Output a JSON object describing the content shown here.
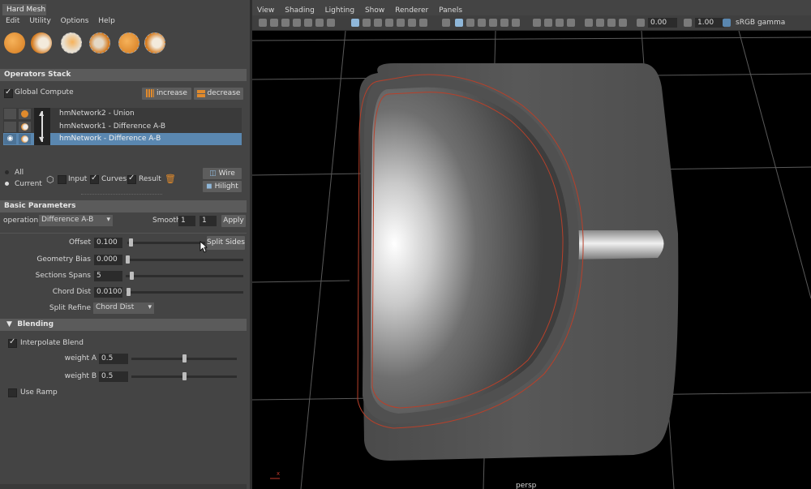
{
  "window": {
    "title": "Hard Mesh"
  },
  "menu": [
    "Edit",
    "Utility",
    "Options",
    "Help"
  ],
  "operators_stack": {
    "header": "Operators Stack",
    "global_compute": "Global Compute",
    "global_compute_checked": true,
    "increase": "increase",
    "decrease": "decrease",
    "items": [
      "hmNetwork2 - Union",
      "hmNetwork1 - Difference A-B",
      "hmNetwork - Difference A-B"
    ],
    "selected_index": 2
  },
  "display": {
    "all": "All",
    "current": "Current",
    "selected": "current",
    "input": "Input",
    "input_checked": false,
    "curves": "Curves",
    "curves_checked": true,
    "result": "Result",
    "result_checked": true,
    "wire": "Wire",
    "hilight": "Hilight"
  },
  "basic": {
    "header": "Basic Parameters",
    "operation_label": "operation",
    "operation_value": "Difference A-B",
    "smooth_label": "Smooth",
    "smooth_1": "1",
    "smooth_2": "1",
    "apply": "Apply",
    "offset_label": "Offset",
    "offset_value": "0.100",
    "split_sides": "Split Sides",
    "geometry_bias_label": "Geometry Bias",
    "geometry_bias_value": "0.000",
    "sections_spans_label": "Sections Spans",
    "sections_spans_value": "5",
    "chord_dist_label": "Chord Dist",
    "chord_dist_value": "0.010000",
    "split_refine_label": "Split Refine",
    "split_refine_value": "Chord Dist"
  },
  "blending": {
    "header": "Blending",
    "interpolate": "Interpolate Blend",
    "interpolate_checked": true,
    "weight_a_label": "weight A",
    "weight_a_value": "0.5",
    "weight_b_label": "weight B",
    "weight_b_value": "0.5",
    "use_ramp": "Use Ramp",
    "use_ramp_checked": false
  },
  "viewport": {
    "menu": [
      "View",
      "Shading",
      "Lighting",
      "Show",
      "Renderer",
      "Panels"
    ],
    "field_a": "0.00",
    "field_b": "1.00",
    "color_space": "sRGB gamma",
    "camera": "persp",
    "axis_x": "x"
  },
  "colors": {
    "accent": "#5a87b0",
    "curve": "#b8402a",
    "panel": "#444444",
    "viewport_bg": "#000000"
  }
}
